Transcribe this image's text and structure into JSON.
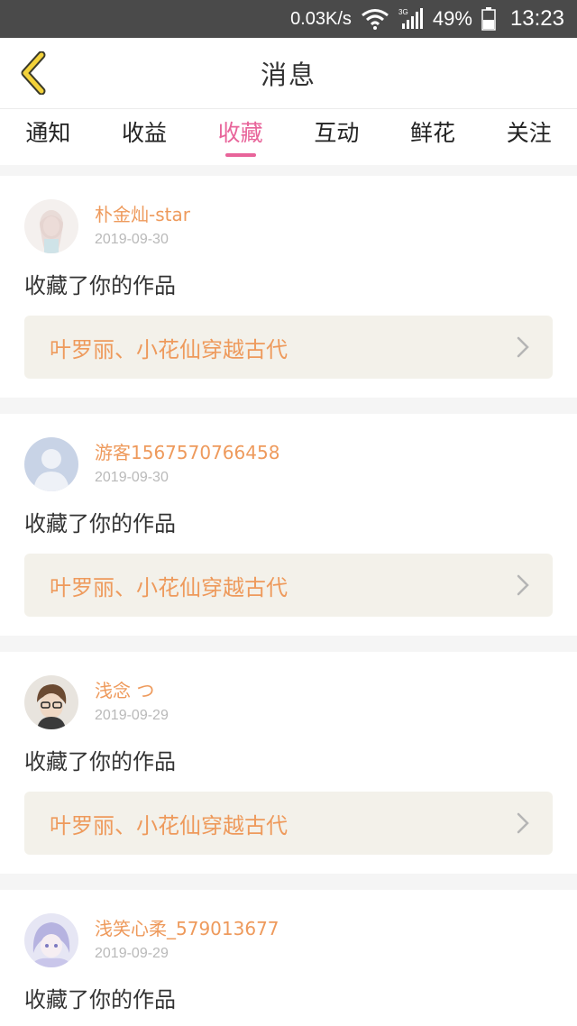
{
  "status_bar": {
    "speed": "0.03K/s",
    "network": "3G",
    "battery": "49%",
    "time": "13:23"
  },
  "header": {
    "title": "消息",
    "back_icon": "chevron-left-icon"
  },
  "tabs": [
    {
      "label": "通知",
      "active": false
    },
    {
      "label": "收益",
      "active": false
    },
    {
      "label": "收藏",
      "active": true
    },
    {
      "label": "互动",
      "active": false
    },
    {
      "label": "鲜花",
      "active": false
    },
    {
      "label": "关注",
      "active": false
    }
  ],
  "colors": {
    "accent": "#e8649a",
    "username": "#ee9a5c",
    "link_bg": "#f3f1ea"
  },
  "messages": [
    {
      "username": "朴金灿-star",
      "date": "2019-09-30",
      "action": "收藏了你的作品",
      "work_title": "叶罗丽、小花仙穿越古代",
      "avatar": "girl-avatar"
    },
    {
      "username": "游客1567570766458",
      "date": "2019-09-30",
      "action": "收藏了你的作品",
      "work_title": "叶罗丽、小花仙穿越古代",
      "avatar": "default-avatar"
    },
    {
      "username": "浅念 つ",
      "date": "2019-09-29",
      "action": "收藏了你的作品",
      "work_title": "叶罗丽、小花仙穿越古代",
      "avatar": "boy-avatar"
    },
    {
      "username": "浅笑心柔_579013677",
      "date": "2019-09-29",
      "action": "收藏了你的作品",
      "avatar": "anime-avatar"
    }
  ]
}
